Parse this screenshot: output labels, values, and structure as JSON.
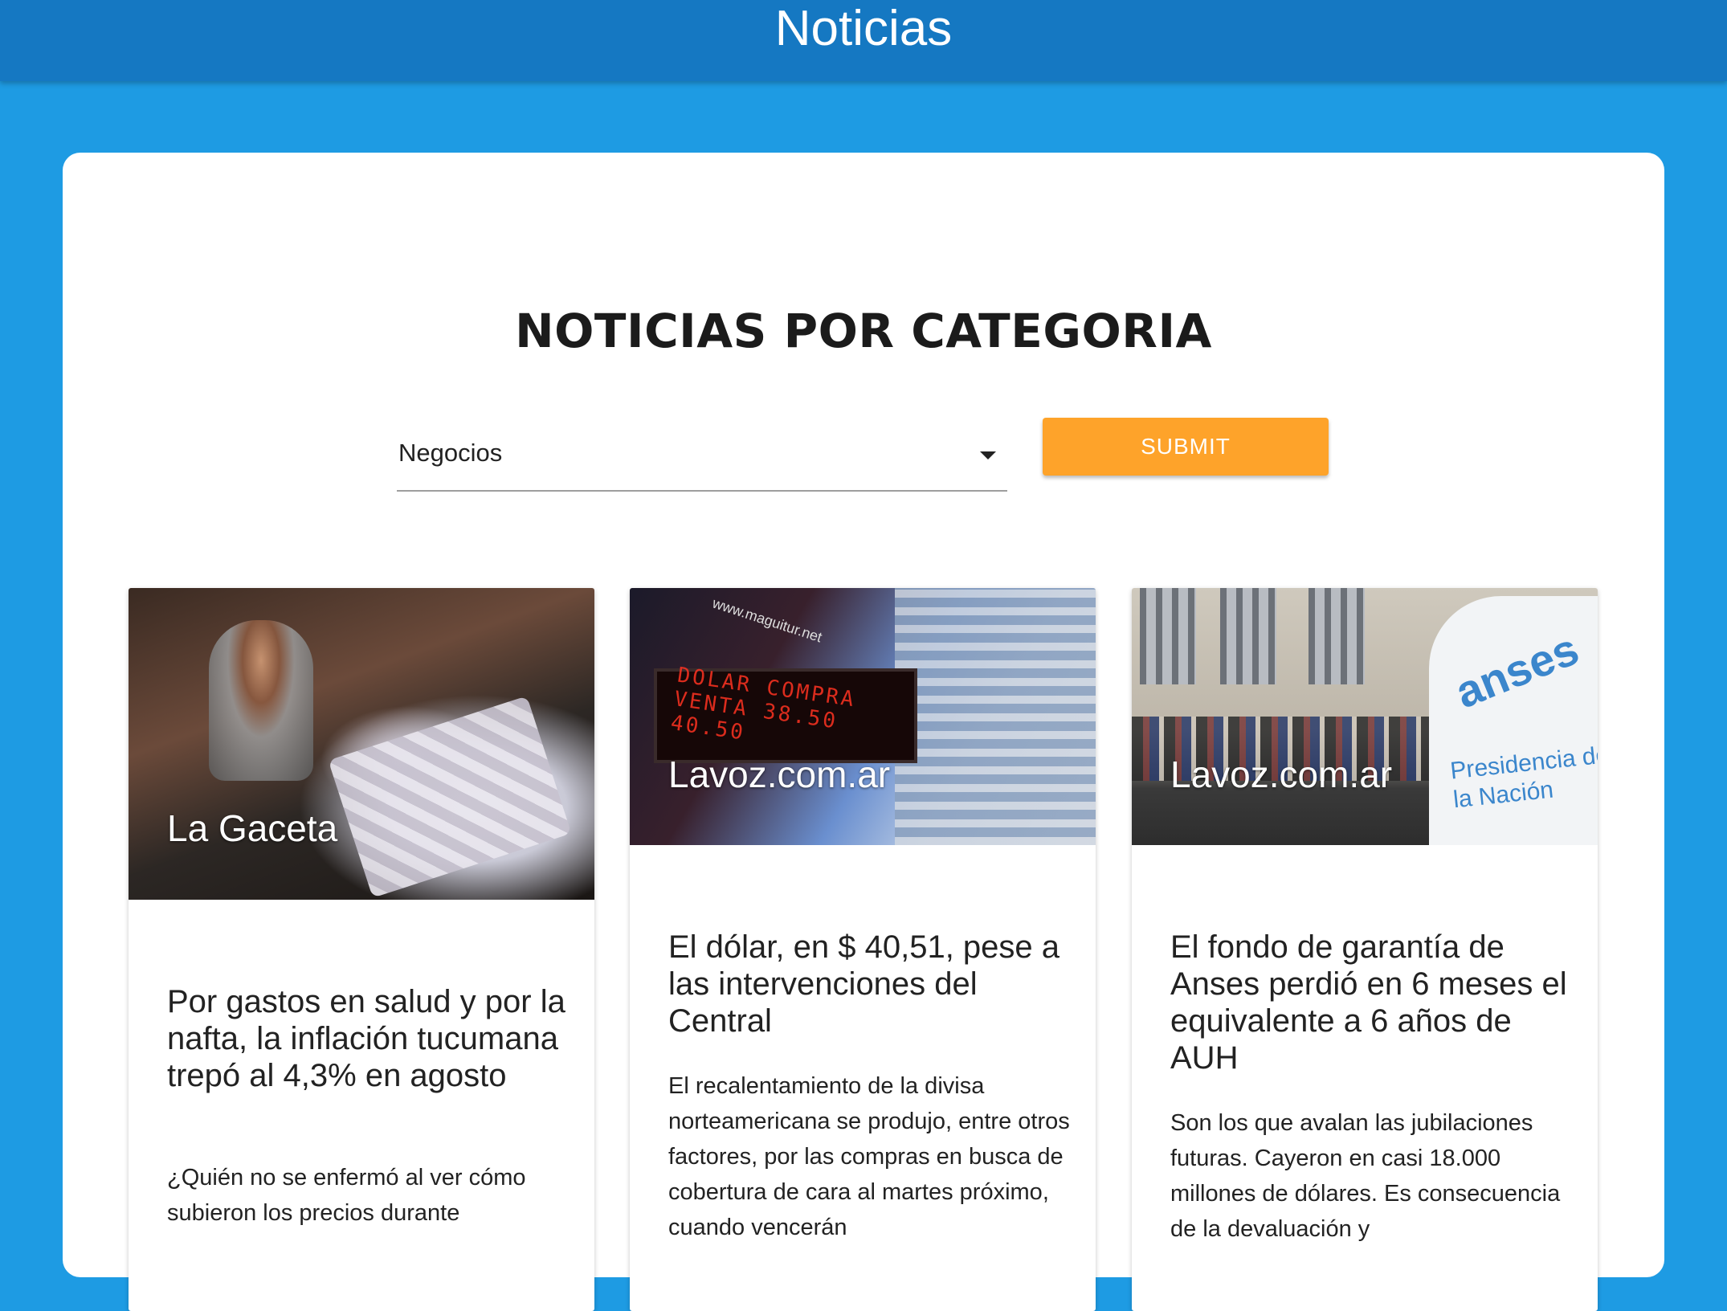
{
  "app": {
    "title": "Noticias"
  },
  "page": {
    "heading": "NOTICIAS POR CATEGORIA"
  },
  "filter": {
    "category_selected": "Negocios",
    "submit_label": "SUBMIT"
  },
  "colors": {
    "topbar": "#1578c2",
    "background": "#1e9be3",
    "submit": "#fea32a"
  },
  "cards": [
    {
      "source": "La Gaceta",
      "headline": "Por gastos en salud y por la nafta, la inflación tucumana trepó al 4,3% en agosto",
      "summary": "¿Quién no se enfermó al ver cómo subieron los precios durante"
    },
    {
      "source": "Lavoz.com.ar",
      "headline": "El dólar, en $ 40,51, pese a las intervenciones del Central",
      "summary": "El recalentamiento de la divisa norteamericana se produjo, entre otros factores, por las compras en busca de cobertura de cara al martes próximo, cuando vencerán",
      "image_text": {
        "board": "DOLAR COMPRA VENTA 38.50 40.50",
        "url": "www.maguitur.net"
      }
    },
    {
      "source": "Lavoz.com.ar",
      "headline": "El fondo de garantía de Anses perdió en 6 meses el equivalente a 6 años de AUH",
      "summary": "Son los que avalan las jubilaciones futuras. Cayeron en casi 18.000 millones de dólares. Es consecuencia de la devaluación y",
      "image_text": {
        "logo": "anses",
        "van": "Presidencia de la Nación"
      }
    }
  ]
}
